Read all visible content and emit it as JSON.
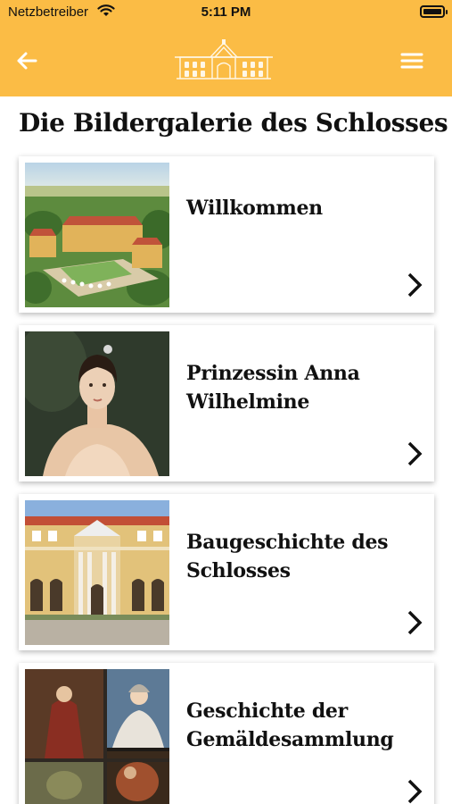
{
  "status_bar": {
    "carrier": "Netzbetreiber",
    "time": "5:11 PM",
    "wifi_icon": "wifi-icon",
    "battery_icon": "battery-icon"
  },
  "nav": {
    "back_icon": "arrow-left-icon",
    "logo_icon": "palace-logo-icon",
    "menu_icon": "hamburger-menu-icon",
    "background": "#fbbc45"
  },
  "page": {
    "title": "Die Bildergalerie des Schlosses"
  },
  "cards": [
    {
      "title": "Willkommen",
      "image": "aerial-palace-photo",
      "chevron_icon": "chevron-right-icon"
    },
    {
      "title": "Prinzessin Anna Wilhelmine",
      "image": "princess-portrait-painting",
      "chevron_icon": "chevron-right-icon"
    },
    {
      "title": "Baugeschichte des Schlosses",
      "image": "palace-facade-photo",
      "chevron_icon": "chevron-right-icon"
    },
    {
      "title": "Geschichte der Gemäldesammlung",
      "image": "painting-collage",
      "chevron_icon": "chevron-right-icon"
    }
  ]
}
